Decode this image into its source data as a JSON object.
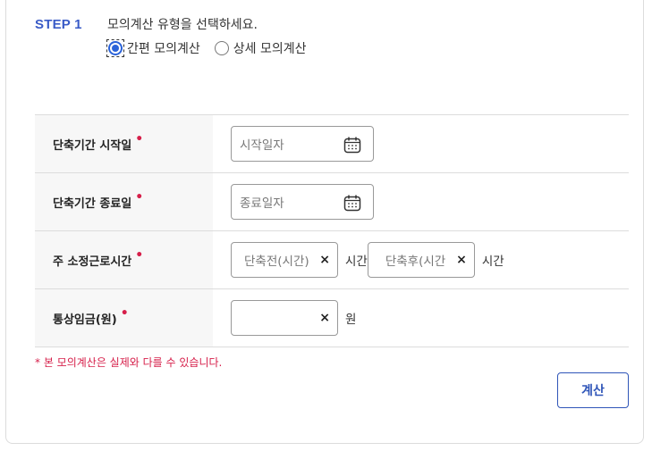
{
  "step": {
    "label": "STEP 1",
    "description": "모의계산 유형을 선택하세요."
  },
  "calc_type": {
    "options": [
      {
        "label": "간편 모의계산",
        "checked": true
      },
      {
        "label": "상세 모의계산",
        "checked": false
      }
    ]
  },
  "form": {
    "rows": [
      {
        "label": "단축기간 시작일",
        "required": "•",
        "placeholder": "시작일자",
        "icon": "calendar-icon"
      },
      {
        "label": "단축기간 종료일",
        "required": "•",
        "placeholder": "종료일자",
        "icon": "calendar-icon"
      },
      {
        "label": "주 소정근로시간",
        "required": "•",
        "before_placeholder": "단축전(시간)",
        "before_unit": "시간",
        "after_placeholder": "단축후(시간",
        "after_unit": "시간"
      },
      {
        "label": "통상임금(원)",
        "required": "•",
        "value": "",
        "unit": "원"
      }
    ],
    "clear_symbol": "×"
  },
  "notice": "* 본 모의계산은 실제와 다를 수 있습니다.",
  "calc_button": "계산",
  "colors": {
    "accent": "#3a5bc7",
    "required": "#d61f4a",
    "button_border": "#2f55b8"
  }
}
